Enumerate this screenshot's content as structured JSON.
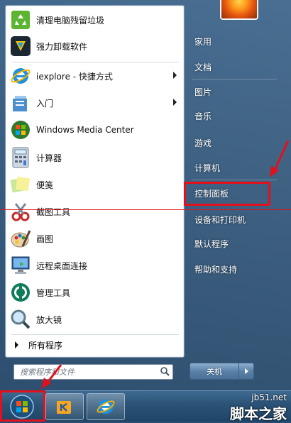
{
  "left_menu": {
    "items": [
      {
        "label": "清理电脑残留垃圾",
        "icon": "recycle-icon"
      },
      {
        "label": "强力卸载软件",
        "icon": "uninstall-shield-icon"
      },
      {
        "label": "iexplore - 快捷方式",
        "icon": "ie-icon",
        "has_submenu": true
      },
      {
        "label": "入门",
        "icon": "getting-started-icon",
        "has_submenu": true
      },
      {
        "label": "Windows Media Center",
        "icon": "media-center-icon"
      },
      {
        "label": "计算器",
        "icon": "calculator-icon"
      },
      {
        "label": "便笺",
        "icon": "sticky-notes-icon"
      },
      {
        "label": "截图工具",
        "icon": "snipping-tool-icon"
      },
      {
        "label": "画图",
        "icon": "paint-icon"
      },
      {
        "label": "远程桌面连接",
        "icon": "remote-desktop-icon"
      },
      {
        "label": "管理工具",
        "icon": "admin-tools-icon"
      },
      {
        "label": "放大镜",
        "icon": "magnifier-icon"
      }
    ],
    "all_programs": "所有程序",
    "search_placeholder": "搜索程序和文件"
  },
  "right_menu": {
    "items": [
      {
        "label": "家用"
      },
      {
        "label": "文档"
      },
      {
        "label": "图片"
      },
      {
        "label": "音乐"
      },
      {
        "label": "游戏"
      },
      {
        "label": "计算机"
      },
      {
        "label": "控制面板"
      },
      {
        "label": "设备和打印机"
      },
      {
        "label": "默认程序"
      },
      {
        "label": "帮助和支持"
      }
    ],
    "shutdown_label": "关机"
  },
  "watermark": {
    "line1": "jb51.net",
    "line2": "脚本之家"
  },
  "colors": {
    "highlight_red": "#e2111b",
    "panel_blue": "#2e5a82"
  }
}
